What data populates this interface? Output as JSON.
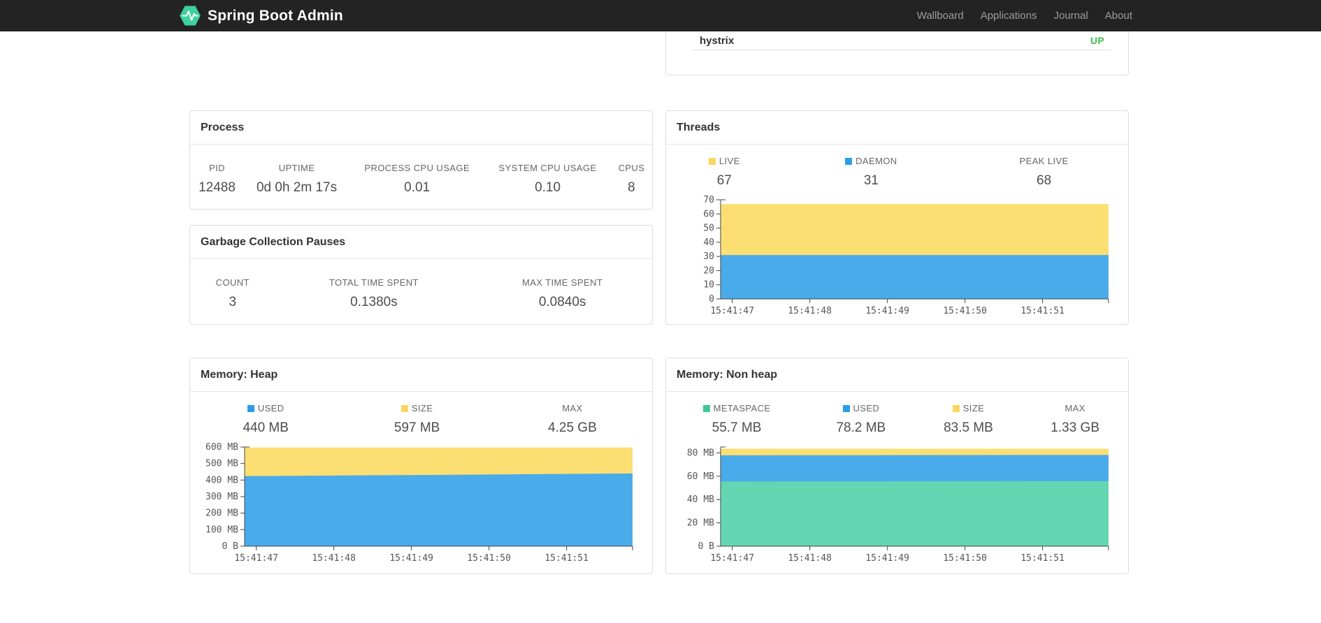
{
  "navbar": {
    "brand": "Spring Boot Admin",
    "links": [
      {
        "label": "Wallboard"
      },
      {
        "label": "Applications"
      },
      {
        "label": "Journal"
      },
      {
        "label": "About"
      }
    ]
  },
  "application": {
    "name": "hystrix",
    "status": "UP",
    "status_color": "#3ac04a"
  },
  "cards": {
    "process": {
      "title": "Process",
      "stats": [
        {
          "label": "PID",
          "value": "12488"
        },
        {
          "label": "UPTIME",
          "value": "0d 0h 2m 17s"
        },
        {
          "label": "PROCESS CPU USAGE",
          "value": "0.01"
        },
        {
          "label": "SYSTEM CPU USAGE",
          "value": "0.10"
        },
        {
          "label": "CPUS",
          "value": "8"
        }
      ]
    },
    "gc": {
      "title": "Garbage Collection Pauses",
      "stats": [
        {
          "label": "COUNT",
          "value": "3"
        },
        {
          "label": "TOTAL TIME SPENT",
          "value": "0.1380s"
        },
        {
          "label": "MAX TIME SPENT",
          "value": "0.0840s"
        }
      ]
    },
    "threads": {
      "title": "Threads",
      "legend": [
        {
          "label": "LIVE",
          "value": "67",
          "color": "#fbd55e"
        },
        {
          "label": "DAEMON",
          "value": "31",
          "color": "#2b9de8"
        },
        {
          "label": "PEAK LIVE",
          "value": "68"
        }
      ]
    },
    "heap": {
      "title": "Memory: Heap",
      "legend": [
        {
          "label": "USED",
          "value": "440 MB",
          "color": "#2b9de8"
        },
        {
          "label": "SIZE",
          "value": "597 MB",
          "color": "#fbd55e"
        },
        {
          "label": "MAX",
          "value": "4.25 GB"
        }
      ]
    },
    "nonheap": {
      "title": "Memory: Non heap",
      "legend": [
        {
          "label": "METASPACE",
          "value": "55.7 MB",
          "color": "#41c795"
        },
        {
          "label": "USED",
          "value": "78.2 MB",
          "color": "#2b9de8"
        },
        {
          "label": "SIZE",
          "value": "83.5 MB",
          "color": "#fbd55e"
        },
        {
          "label": "MAX",
          "value": "1.33 GB"
        }
      ]
    }
  },
  "chart_data": [
    {
      "type": "area",
      "title": "Threads",
      "x": [
        "15:41:47",
        "15:41:48",
        "15:41:49",
        "15:41:50",
        "15:41:51"
      ],
      "xtick_fracs": [
        0.03,
        0.23,
        0.43,
        0.63,
        0.83
      ],
      "ylim": [
        0,
        70
      ],
      "yticks": [
        0,
        10,
        20,
        30,
        40,
        50,
        60,
        70
      ],
      "ytick_labels": [
        "0",
        "10",
        "20",
        "30",
        "40",
        "50",
        "60",
        "70"
      ],
      "grid": false,
      "legend_position": "above-chart",
      "series": [
        {
          "name": "LIVE",
          "color": "#fcdf73",
          "values": [
            67,
            67,
            67,
            67,
            67,
            67
          ]
        },
        {
          "name": "DAEMON",
          "color": "#4aabea",
          "values": [
            31,
            31,
            31,
            31,
            31,
            31
          ]
        }
      ]
    },
    {
      "type": "area",
      "title": "Memory: Heap",
      "x": [
        "15:41:47",
        "15:41:48",
        "15:41:49",
        "15:41:50",
        "15:41:51"
      ],
      "xtick_fracs": [
        0.03,
        0.23,
        0.43,
        0.63,
        0.83
      ],
      "ylim": [
        0,
        600
      ],
      "yticks": [
        0,
        100,
        200,
        300,
        400,
        500,
        600
      ],
      "ytick_labels": [
        "0 B",
        "100 MB",
        "200 MB",
        "300 MB",
        "400 MB",
        "500 MB",
        "600 MB"
      ],
      "grid": false,
      "legend_position": "above-chart",
      "series": [
        {
          "name": "SIZE",
          "color": "#fcdf73",
          "values": [
            597,
            597,
            597,
            597,
            597,
            597
          ]
        },
        {
          "name": "USED",
          "color": "#4aabea",
          "values": [
            424,
            427,
            430,
            433,
            437,
            440
          ]
        }
      ]
    },
    {
      "type": "area",
      "title": "Memory: Non heap",
      "x": [
        "15:41:47",
        "15:41:48",
        "15:41:49",
        "15:41:50",
        "15:41:51"
      ],
      "xtick_fracs": [
        0.03,
        0.23,
        0.43,
        0.63,
        0.83
      ],
      "ylim": [
        0,
        85
      ],
      "yticks": [
        0,
        20,
        40,
        60,
        80
      ],
      "ytick_labels": [
        "0 B",
        "20 MB",
        "40 MB",
        "60 MB",
        "80 MB"
      ],
      "grid": false,
      "legend_position": "above-chart",
      "series": [
        {
          "name": "SIZE",
          "color": "#fcdf73",
          "values": [
            83.5,
            83.5,
            83.5,
            83.5,
            83.5,
            83.5
          ]
        },
        {
          "name": "USED",
          "color": "#4aabea",
          "values": [
            77.9,
            78.0,
            78.0,
            78.1,
            78.2,
            78.2
          ]
        },
        {
          "name": "METASPACE",
          "color": "#63d6b2",
          "values": [
            55.4,
            55.5,
            55.5,
            55.6,
            55.7,
            55.7
          ]
        }
      ]
    }
  ]
}
